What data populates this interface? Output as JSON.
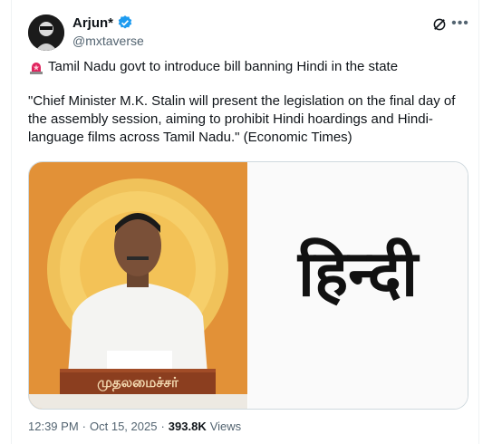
{
  "author": {
    "display_name": "Arjun*",
    "handle": "@mxtaverse"
  },
  "post": {
    "headline": "Tamil Nadu govt to introduce bill banning Hindi in the state",
    "quote": "\"Chief Minister M.K. Stalin will present the legislation on the final day of the assembly session, aiming to prohibit Hindi hoardings and Hindi-language films across Tamil Nadu.\" (Economic Times)"
  },
  "media": {
    "podium_text": "முதலமைச்சர்",
    "hindi_text": "हिन्दी"
  },
  "meta": {
    "time": "12:39 PM",
    "separator": "·",
    "date": "Oct 15, 2025",
    "separator2": "·",
    "views_count": "393.8K",
    "views_label": "Views"
  },
  "colors": {
    "verified": "#1d9bf0",
    "muted": "#536471",
    "siren": "#e0245e"
  },
  "icons": [
    "verified-badge-icon",
    "grok-icon",
    "more-icon",
    "siren-icon"
  ]
}
